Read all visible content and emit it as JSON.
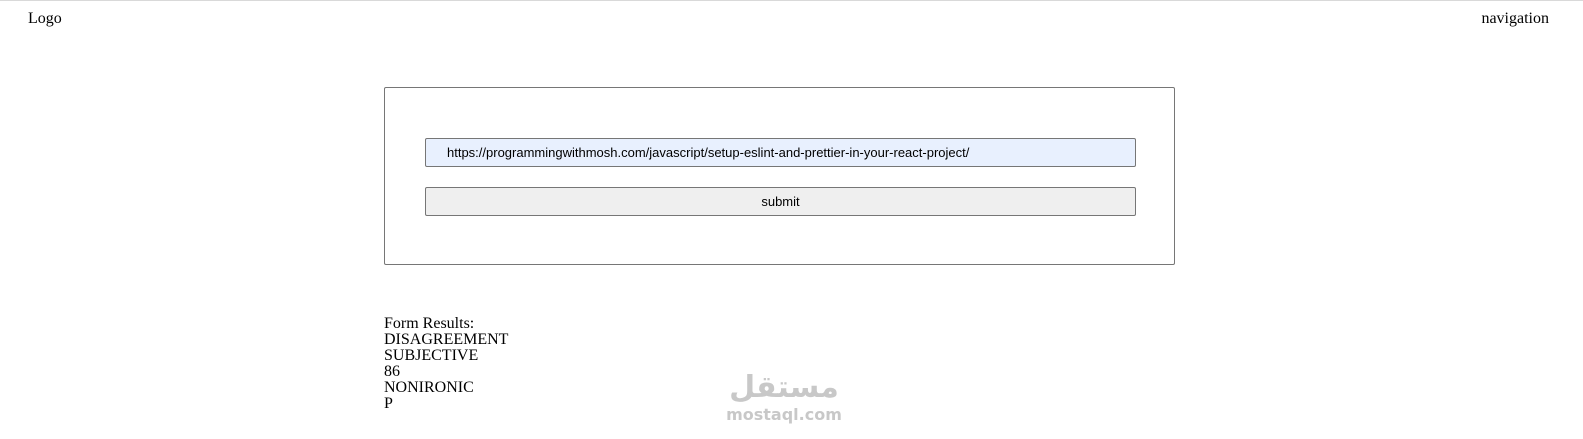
{
  "header": {
    "logo_text": "Logo",
    "nav_text": "navigation"
  },
  "form": {
    "url_value": "https://programmingwithmosh.com/javascript/setup-eslint-and-prettier-in-your-react-project/",
    "submit_label": "submit"
  },
  "results": {
    "title": "Form Results:",
    "items": [
      "DISAGREEMENT",
      "SUBJECTIVE",
      "86",
      "NONIRONIC",
      "P"
    ]
  },
  "watermark": {
    "arabic_text": "مستقل",
    "latin_text": "mostaql.com"
  },
  "colors": {
    "input_background": "#e8f0fe",
    "button_background": "#efefef",
    "border": "#767676",
    "watermark": "#c8c8c8"
  }
}
